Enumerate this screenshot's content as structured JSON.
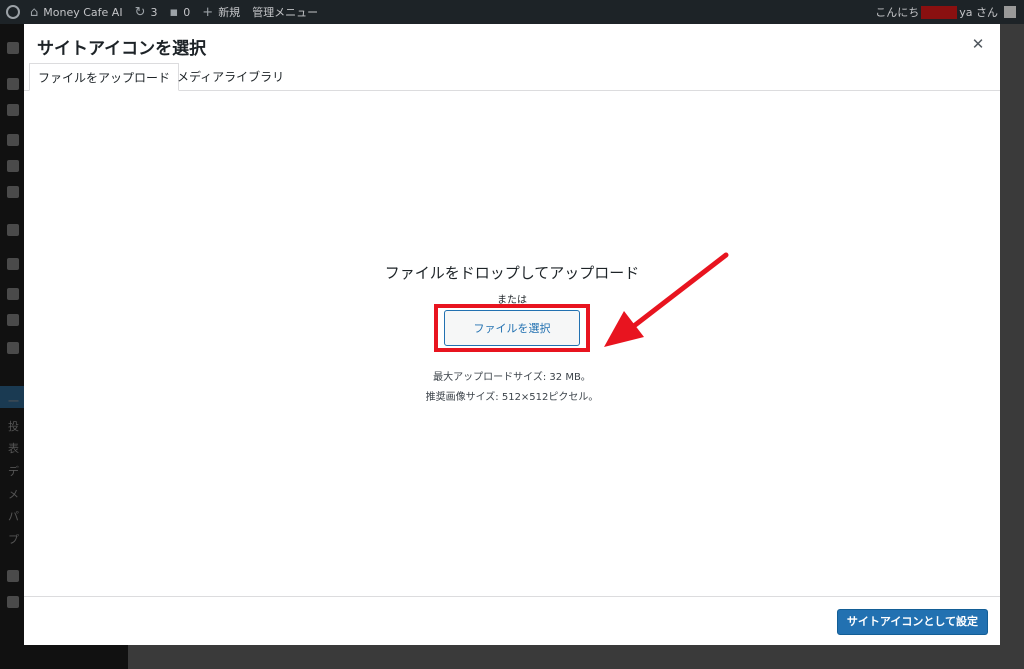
{
  "admin_bar": {
    "site_name": "Money Cafe AI",
    "updates_count": "3",
    "comments_count": "0",
    "new_label": "新規",
    "admin_menu_label": "管理メニュー",
    "greeting_prefix": "こんにち",
    "greeting_suffix": "ya さん"
  },
  "admin_menu_fragments": [
    "一",
    "投",
    "表",
    "デ",
    "メ",
    "パ",
    "プ"
  ],
  "modal": {
    "title": "サイトアイコンを選択",
    "tabs": [
      {
        "label": "ファイルをアップロード",
        "active": true
      },
      {
        "label": "メディアライブラリ",
        "active": false
      }
    ],
    "drop_text": "ファイルをドロップしてアップロード",
    "or_text": "または",
    "select_button": "ファイルを選択",
    "max_upload": "最大アップロードサイズ: 32 MB。",
    "recommended_size": "推奨画像サイズ: 512×512ピクセル。",
    "primary_button": "サイトアイコンとして設定"
  },
  "colors": {
    "accent": "#2271b1",
    "highlight_box": "#e8141f",
    "admin_bar": "#1d2327"
  },
  "icons": [
    "wordpress-logo-icon",
    "home-icon",
    "refresh-icon",
    "comment-icon",
    "plus-icon",
    "close-icon",
    "red-arrow-icon"
  ]
}
